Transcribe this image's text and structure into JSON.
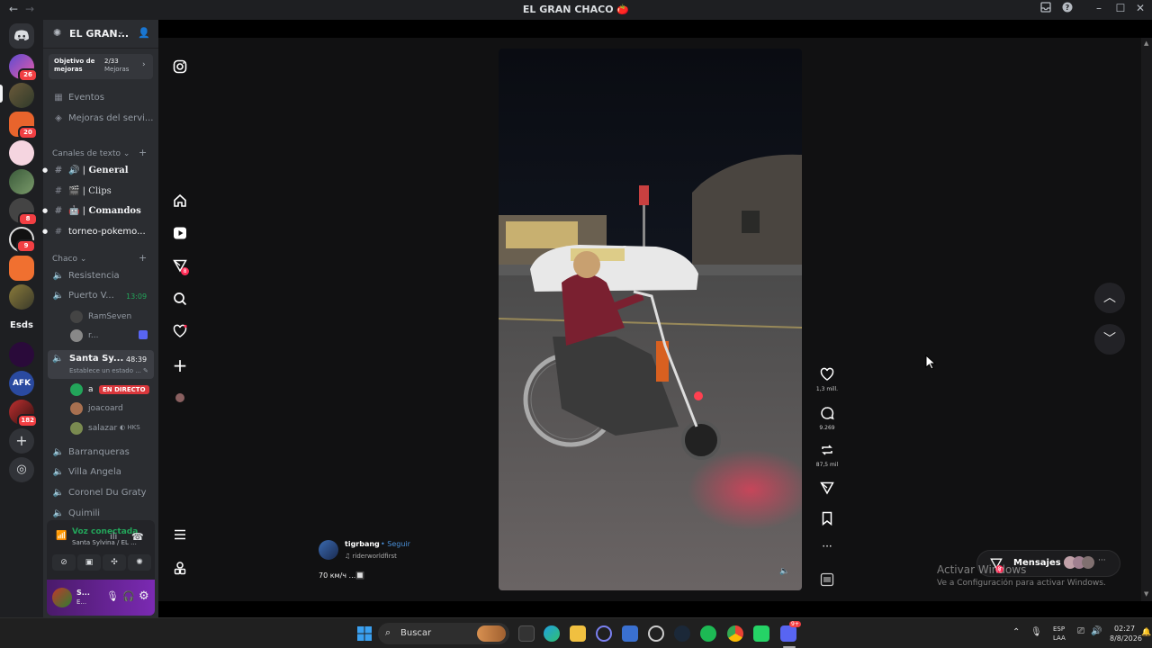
{
  "titlebar": {
    "title": "EL GRAN CHACO 🍅",
    "back": "←",
    "forward": "→"
  },
  "servers": {
    "badges": [
      "26",
      "20",
      "8",
      "9",
      "182"
    ],
    "text_server": "Esds",
    "afk_label": "AFK"
  },
  "guild": {
    "name": "EL GRAN...",
    "boost_goal_label": "Objetivo de mejoras",
    "boost_count": "2/33",
    "boost_unit": "Mejoras",
    "events": "Eventos",
    "boosts": "Mejoras del servi...",
    "text_category": "Canales de texto",
    "text_channels": [
      {
        "name": "General",
        "prefix": "🔊 |"
      },
      {
        "name": "Clips",
        "prefix": "🎬 |"
      },
      {
        "name": "Comandos",
        "prefix": "🤖 |"
      },
      {
        "name": "torneo-pokemo...",
        "prefix": ""
      }
    ],
    "voice_category": "Chaco",
    "voice_channels": {
      "resistencia": "Resistencia",
      "puerto": "Puerto V...",
      "puerto_time": "13:09",
      "puerto_users": [
        "RamSeven",
        "r..."
      ],
      "santa": "Santa Sy...",
      "santa_time": "48:39",
      "santa_status": "Establece un estado ...",
      "santa_users": [
        "a",
        "joacoard",
        "salazar"
      ],
      "live_badge": "EN DIRECTO",
      "hks_tag": "HKS",
      "barranqueras": "Barranqueras",
      "villa": "Villa Angela",
      "coronel": "Coronel Du Graty",
      "quimili": "Quimili"
    }
  },
  "voice_panel": {
    "status": "Voz conectada",
    "location": "Santa Sylvina / EL ...",
    "user_short": "S...",
    "user_sub": "E..."
  },
  "video": {
    "likes": "1,3 mill.",
    "comments": "9.269",
    "reposts": "87,5 mil",
    "author": "tigrbang",
    "follow": "• Seguir",
    "audio": "riderworldfirst",
    "caption": "70 км/ч ...🔲",
    "inbox_badge": "8"
  },
  "messages_bar": {
    "label": "Mensajes",
    "badge": "8"
  },
  "watermark": {
    "line1": "Activar Windows",
    "line2": "Ve a Configuración para activar Windows."
  },
  "taskbar": {
    "search": "Buscar",
    "lang": "ESP",
    "region": "LAA",
    "time": "02:27",
    "date": "8/8/2026",
    "discord_badge": "9+"
  },
  "colors": {
    "discord_blurple": "#5865f2",
    "online": "#23a55a",
    "live_red": "#da373c",
    "accent_purple": "#7b2ab3"
  }
}
